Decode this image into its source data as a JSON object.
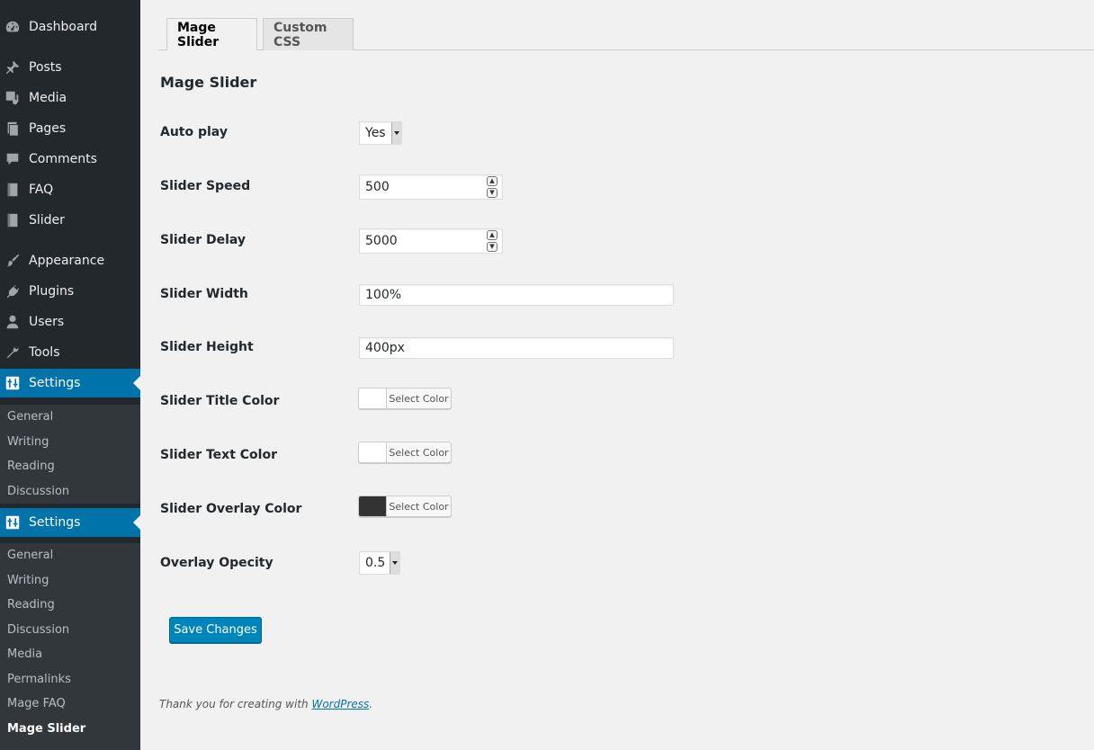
{
  "sidebar": {
    "items": [
      {
        "label": "Dashboard",
        "icon": "dashboard-icon"
      },
      {
        "label": "Posts",
        "icon": "pin-icon"
      },
      {
        "label": "Media",
        "icon": "media-icon"
      },
      {
        "label": "Pages",
        "icon": "pages-icon"
      },
      {
        "label": "Comments",
        "icon": "comment-icon"
      },
      {
        "label": "FAQ",
        "icon": "book-icon"
      },
      {
        "label": "Slider",
        "icon": "book-icon"
      },
      {
        "label": "Appearance",
        "icon": "brush-icon"
      },
      {
        "label": "Plugins",
        "icon": "plugin-icon"
      },
      {
        "label": "Users",
        "icon": "user-icon"
      },
      {
        "label": "Tools",
        "icon": "wrench-icon"
      }
    ],
    "settings_label": "Settings",
    "submenu1": [
      "General",
      "Writing",
      "Reading",
      "Discussion"
    ],
    "submenu2": [
      "General",
      "Writing",
      "Reading",
      "Discussion",
      "Media",
      "Permalinks",
      "Mage FAQ",
      "Mage Slider"
    ],
    "accent_color": "#0073aa"
  },
  "tabs": [
    {
      "label": "Mage Slider",
      "active": true
    },
    {
      "label": "Custom CSS",
      "active": false
    }
  ],
  "section_title": "Mage Slider",
  "fields": {
    "auto_play": {
      "label": "Auto play",
      "value": "Yes"
    },
    "slider_speed": {
      "label": "Slider Speed",
      "value": "500"
    },
    "slider_delay": {
      "label": "Slider Delay",
      "value": "5000"
    },
    "slider_width": {
      "label": "Slider Width",
      "value": "100%"
    },
    "slider_height": {
      "label": "Slider Height",
      "value": "400px"
    },
    "title_color": {
      "label": "Slider Title Color",
      "button": "Select Color",
      "color": "#ffffff"
    },
    "text_color": {
      "label": "Slider Text Color",
      "button": "Select Color",
      "color": "#ffffff"
    },
    "overlay_color": {
      "label": "Slider Overlay Color",
      "button": "Select Color",
      "color": "#333333"
    },
    "overlay_opacity": {
      "label": "Overlay Opecity",
      "value": "0.5"
    }
  },
  "save_label": "Save Changes",
  "footer": {
    "prefix": "Thank you for creating with ",
    "link": "WordPress",
    "suffix": "."
  }
}
